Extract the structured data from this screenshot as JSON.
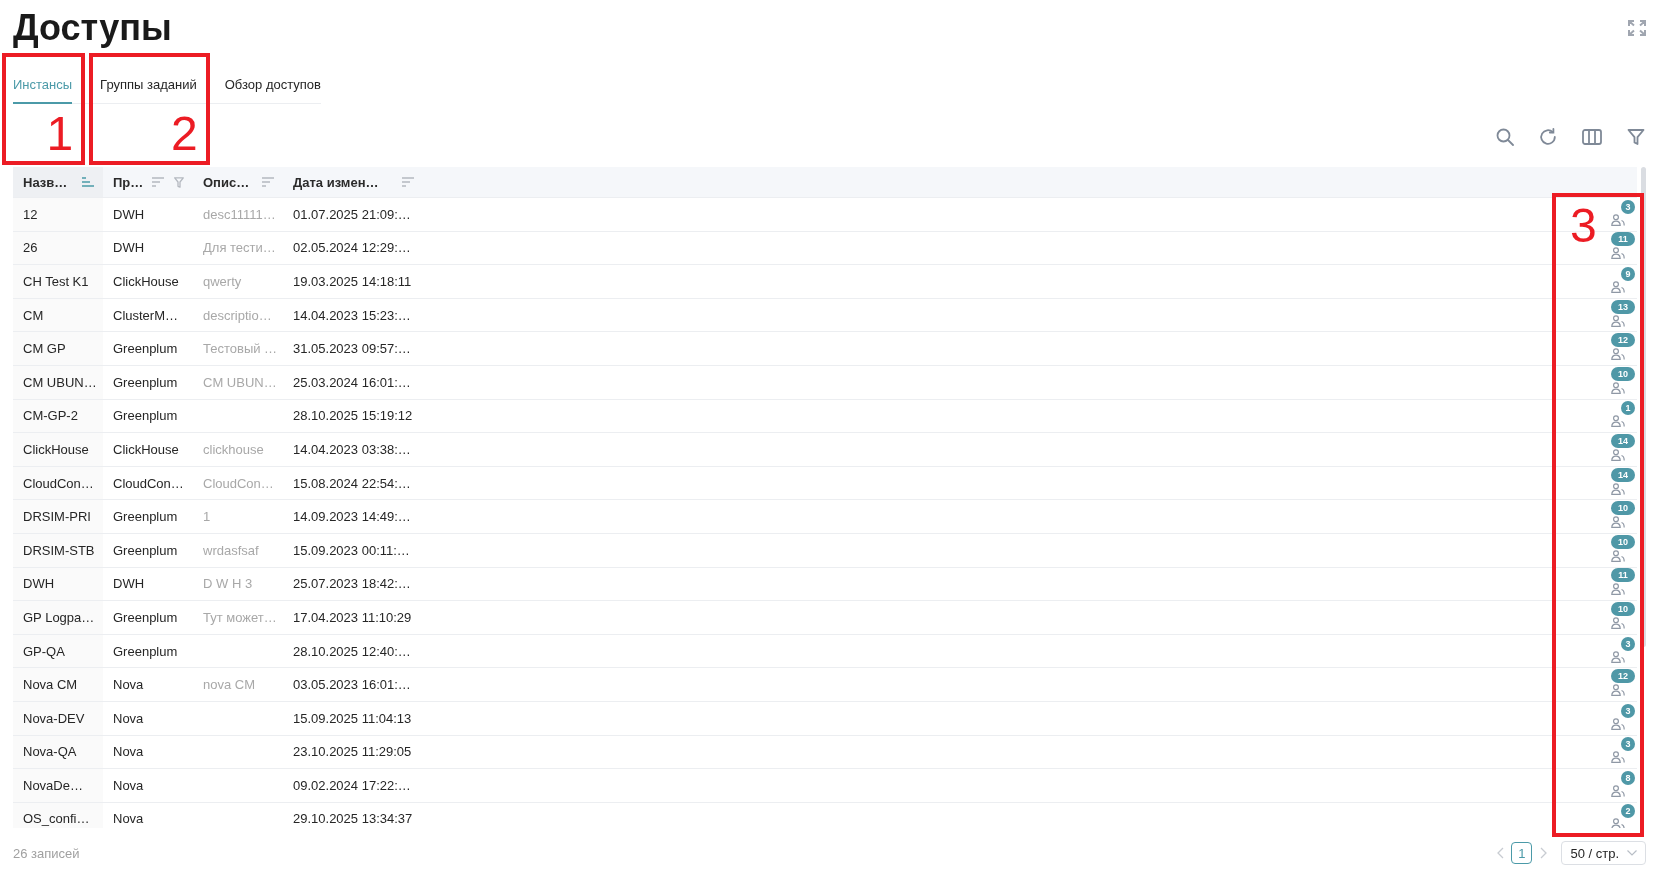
{
  "page": {
    "title": "Доступы"
  },
  "tabs": [
    {
      "label": "Инстансы",
      "selected": true,
      "annotation": "1"
    },
    {
      "label": "Группы заданий",
      "selected": false,
      "annotation": "2"
    },
    {
      "label": "Обзор доступов",
      "selected": false
    }
  ],
  "table": {
    "columns": [
      {
        "label": "Назв…",
        "sorted": true,
        "filter": false
      },
      {
        "label": "Пр…",
        "sorted": false,
        "filter": true
      },
      {
        "label": "Опис…",
        "sorted": false,
        "filter": false
      },
      {
        "label": "Дата измен…",
        "sorted": false,
        "filter": false
      }
    ],
    "annotation": "3",
    "rows": [
      {
        "column_1": "12",
        "column_2": "DWH",
        "column_3": "desc11111…",
        "column_4": "01.07.2025 21:09:…",
        "column_5": "3"
      },
      {
        "column_1": "26",
        "column_2": "DWH",
        "column_3": "Для тести…",
        "column_4": "02.05.2024 12:29:…",
        "column_5": "11"
      },
      {
        "column_1": "CH Test K1",
        "column_2": "ClickHouse",
        "column_3": "qwerty",
        "column_4": "19.03.2025 14:18:11",
        "column_5": "9"
      },
      {
        "column_1": "CM",
        "column_2": "ClusterM…",
        "column_3": "descriptio…",
        "column_4": "14.04.2023 15:23:…",
        "column_5": "13"
      },
      {
        "column_1": "CM GP",
        "column_2": "Greenplum",
        "column_3": "Тестовый …",
        "column_4": "31.05.2023 09:57:…",
        "column_5": "12"
      },
      {
        "column_1": "CM UBUN…",
        "column_2": "Greenplum",
        "column_3": "CM UBUN…",
        "column_4": "25.03.2024 16:01:…",
        "column_5": "10"
      },
      {
        "column_1": "CM-GP-2",
        "column_2": "Greenplum",
        "column_4": "28.10.2025 15:19:12",
        "column_5": "1"
      },
      {
        "column_1": "ClickHouse",
        "column_2": "ClickHouse",
        "column_3": "clickhouse",
        "column_4": "14.04.2023 03:38:…",
        "column_5": "14"
      },
      {
        "column_1": "CloudCon…",
        "column_2": "CloudCon…",
        "column_3": "CloudCon…",
        "column_4": "15.08.2024 22:54:…",
        "column_5": "14"
      },
      {
        "column_1": "DRSIM-PRI",
        "column_2": "Greenplum",
        "column_3": "1",
        "column_4": "14.09.2023 14:49:…",
        "column_5": "10"
      },
      {
        "column_1": "DRSIM-STB",
        "column_2": "Greenplum",
        "column_3": "wrdasfsaf",
        "column_4": "15.09.2023 00:11:…",
        "column_5": "10"
      },
      {
        "column_1": "DWH",
        "column_2": "DWH",
        "column_3": "D W H 3",
        "column_4": "25.07.2023 18:42:…",
        "column_5": "11"
      },
      {
        "column_1": "GP Logpa…",
        "column_2": "Greenplum",
        "column_3": "Тут может…",
        "column_4": "17.04.2023 11:10:29",
        "column_5": "10"
      },
      {
        "column_1": "GP-QA",
        "column_2": "Greenplum",
        "column_4": "28.10.2025 12:40:…",
        "column_5": "3"
      },
      {
        "column_1": "Nova CM",
        "column_2": "Nova",
        "column_3": "nova CM",
        "column_4": "03.05.2023 16:01:…",
        "column_5": "12"
      },
      {
        "column_1": "Nova-DEV",
        "column_2": "Nova",
        "column_4": "15.09.2025 11:04:13",
        "column_5": "3"
      },
      {
        "column_1": "Nova-QA",
        "column_2": "Nova",
        "column_4": "23.10.2025 11:29:05",
        "column_5": "3"
      },
      {
        "column_1": "NovaDe…",
        "column_2": "Nova",
        "column_4": "09.02.2024 17:22:…",
        "column_5": "8"
      },
      {
        "column_1": "OS_confi…",
        "column_2": "Nova",
        "column_4": "29.10.2025 13:34:37",
        "column_5": "2"
      }
    ]
  },
  "footer": {
    "total": "26 записей",
    "pagination": {
      "prev_disabled": true,
      "pages": [
        {
          "label": "1",
          "selected": true
        }
      ],
      "next_disabled": true,
      "page_size": "50 / стр."
    }
  }
}
